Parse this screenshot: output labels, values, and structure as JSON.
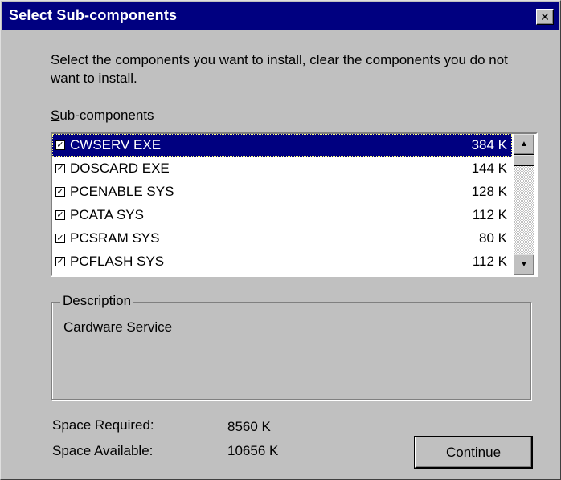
{
  "window": {
    "title": "Select Sub-components",
    "close_glyph": "✕"
  },
  "instructions": "Select the components you want to install, clear the components you do not want to install.",
  "subcomponents_label": {
    "accesskey": "S",
    "rest": "ub-components"
  },
  "list": {
    "items": [
      {
        "name": "CWSERV EXE",
        "size": "384 K",
        "checked": true,
        "selected": true
      },
      {
        "name": "DOSCARD EXE",
        "size": "144 K",
        "checked": true,
        "selected": false
      },
      {
        "name": "PCENABLE SYS",
        "size": "128 K",
        "checked": true,
        "selected": false
      },
      {
        "name": "PCATA SYS",
        "size": "112 K",
        "checked": true,
        "selected": false
      },
      {
        "name": "PCSRAM SYS",
        "size": "80 K",
        "checked": true,
        "selected": false
      },
      {
        "name": "PCFLASH SYS",
        "size": "112 K",
        "checked": true,
        "selected": false
      }
    ],
    "check_glyph": "✓",
    "scroll_up_glyph": "▲",
    "scroll_down_glyph": "▼"
  },
  "description": {
    "legend": "Description",
    "text": "Cardware Service"
  },
  "space": {
    "required_label": "Space Required:",
    "required_value": "8560 K",
    "available_label": "Space Available:",
    "available_value": "10656 K"
  },
  "continue_button": {
    "accesskey": "C",
    "rest": "ontinue"
  }
}
